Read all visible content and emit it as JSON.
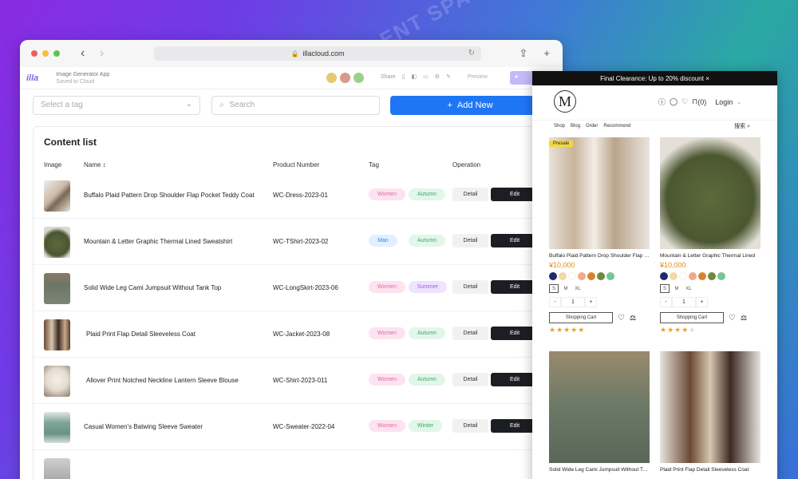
{
  "browser": {
    "url": "illacloud.com"
  },
  "app": {
    "logo": "illa",
    "name": "Image Generator App",
    "saved": "Saved to Cloud",
    "share": "Share",
    "preview": "Preview"
  },
  "filters": {
    "tag_placeholder": "Select a tag",
    "search_placeholder": "Search",
    "add_label": "Add New"
  },
  "table": {
    "title": "Content list",
    "headers": {
      "image": "Image",
      "name": "Name ↕",
      "number": "Product Number",
      "tag": "Tag",
      "operation": "Operation"
    },
    "detail_label": "Detail",
    "edit_label": "Edit",
    "rows": [
      {
        "name": "Buffalo Plaid Pattern Drop Shoulder Flap Pocket Teddy Coat",
        "number": "WC-Dress-2023-01",
        "gender": "Women",
        "season": "Autumn"
      },
      {
        "name": "Mountain & Letter Graphic Thermal Lined Sweatshirt",
        "number": "WC-TShirt-2023-02",
        "gender": "Man",
        "season": "Autumn"
      },
      {
        "name": "Solid Wide Leg Cami Jumpsuit Without Tank Top",
        "number": "WC-LongSkirt-2023-06",
        "gender": "Women",
        "season": "Summer"
      },
      {
        "name": "Plaid Print Flap Detail Sleeveless Coat",
        "number": "WC-Jacket-2023-08",
        "gender": "Women",
        "season": "Autumn"
      },
      {
        "name": "Allover Print Notched Neckline Lantern Sleeve Blouse",
        "number": "WC-Shirt-2023-011",
        "gender": "Women",
        "season": "Autumn"
      },
      {
        "name": "Casual Women's Batwing Sleeve Sweater",
        "number": "WC-Sweater-2022-04",
        "gender": "Women",
        "season": "Winter"
      }
    ]
  },
  "shop": {
    "banner": "Final Clearance: Up to 20% discount ×",
    "logo": "M",
    "cart_count": "(0)",
    "login": "Login",
    "nav": [
      "Shop",
      "Blog",
      "Order",
      "Recommend"
    ],
    "search_label": "搜索",
    "presale": "Presale",
    "cart_label": "Shopping Cart",
    "products": [
      {
        "name": "Buffalo Plaid Pattern Drop Shoulder Flap Pocket",
        "price": "¥10,000",
        "rating": 5,
        "qty": "1"
      },
      {
        "name": "Mountain & Letter Graphic Thermal Lined",
        "price": "¥10,000",
        "rating": 4,
        "qty": "1"
      },
      {
        "name": "Solid Wide Leg Cami Jumpsuit Without Tank Top",
        "price": "¥10,000"
      },
      {
        "name": "Plaid Print Flap Detail Sleeveless Coat",
        "price": "¥10,000"
      }
    ],
    "sizes": [
      "S",
      "M",
      "XL"
    ],
    "swatch_colors": [
      "#1f2a6b",
      "#f3d9a6",
      "#ffffff",
      "#f0a98a",
      "#d9822b",
      "#6e8a3a",
      "#79c39a"
    ]
  },
  "watermark": "AI TALENT SPACE"
}
